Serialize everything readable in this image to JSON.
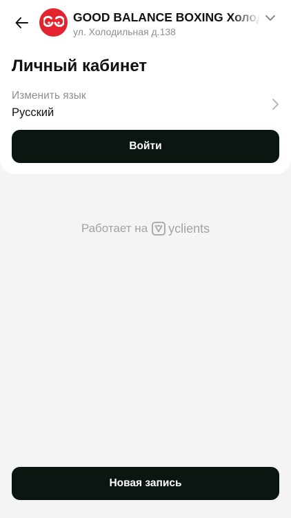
{
  "header": {
    "back_icon": "arrow-left-icon",
    "logo_icon": "boxing-gloves-logo",
    "studio_name": "GOOD BALANCE BOXING Холодильная",
    "studio_address": "ул. Холодильная д.138",
    "dropdown_icon": "chevron-down-icon"
  },
  "main": {
    "title": "Личный кабинет",
    "language": {
      "label": "Изменить язык",
      "value": "Русский",
      "icon": "chevron-right-icon"
    },
    "login_button": "Войти"
  },
  "footer": {
    "powered_by_text": "Работает на",
    "brand_name": "yclients",
    "brand_icon": "yclients-logo-icon",
    "new_booking_button": "Новая запись"
  },
  "colors": {
    "background": "#f4f4f4",
    "card": "#ffffff",
    "button": "#0c1610",
    "logo": "#e3232d",
    "muted_text": "#8e8e8e"
  }
}
